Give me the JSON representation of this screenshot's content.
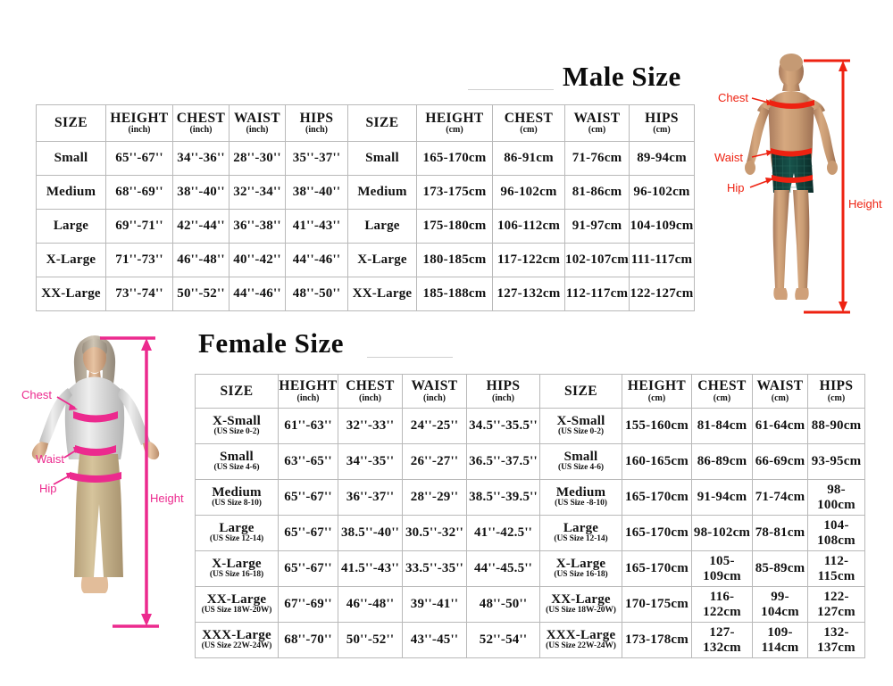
{
  "male": {
    "title": "Male Size",
    "headers": [
      {
        "main": "SIZE",
        "unit": ""
      },
      {
        "main": "HEIGHT",
        "unit": "(inch)"
      },
      {
        "main": "CHEST",
        "unit": "(inch)"
      },
      {
        "main": "WAIST",
        "unit": "(inch)"
      },
      {
        "main": "HIPS",
        "unit": "(inch)"
      },
      {
        "main": "SIZE",
        "unit": ""
      },
      {
        "main": "HEIGHT",
        "unit": "(cm)"
      },
      {
        "main": "CHEST",
        "unit": "(cm)"
      },
      {
        "main": "WAIST",
        "unit": "(cm)"
      },
      {
        "main": "HIPS",
        "unit": "(cm)"
      }
    ],
    "rows": [
      {
        "size_in": "Small",
        "height_in": "65''-67''",
        "chest_in": "34''-36''",
        "waist_in": "28''-30''",
        "hips_in": "35''-37''",
        "size_cm": "Small",
        "height_cm": "165-170cm",
        "chest_cm": "86-91cm",
        "waist_cm": "71-76cm",
        "hips_cm": "89-94cm"
      },
      {
        "size_in": "Medium",
        "height_in": "68''-69''",
        "chest_in": "38''-40''",
        "waist_in": "32''-34''",
        "hips_in": "38''-40''",
        "size_cm": "Medium",
        "height_cm": "173-175cm",
        "chest_cm": "96-102cm",
        "waist_cm": "81-86cm",
        "hips_cm": "96-102cm"
      },
      {
        "size_in": "Large",
        "height_in": "69''-71''",
        "chest_in": "42''-44''",
        "waist_in": "36''-38''",
        "hips_in": "41''-43''",
        "size_cm": "Large",
        "height_cm": "175-180cm",
        "chest_cm": "106-112cm",
        "waist_cm": "91-97cm",
        "hips_cm": "104-109cm"
      },
      {
        "size_in": "X-Large",
        "height_in": "71''-73''",
        "chest_in": "46''-48''",
        "waist_in": "40''-42''",
        "hips_in": "44''-46''",
        "size_cm": "X-Large",
        "height_cm": "180-185cm",
        "chest_cm": "117-122cm",
        "waist_cm": "102-107cm",
        "hips_cm": "111-117cm"
      },
      {
        "size_in": "XX-Large",
        "height_in": "73''-74''",
        "chest_in": "50''-52''",
        "waist_in": "44''-46''",
        "hips_in": "48''-50''",
        "size_cm": "XX-Large",
        "height_cm": "185-188cm",
        "chest_cm": "127-132cm",
        "waist_cm": "112-117cm",
        "hips_cm": "122-127cm"
      }
    ],
    "figure": {
      "chest_label": "Chest",
      "waist_label": "Waist",
      "hip_label": "Hip",
      "height_label": "Height",
      "accent_color": "#ee2211"
    }
  },
  "female": {
    "title": "Female Size",
    "headers": [
      {
        "main": "SIZE",
        "unit": ""
      },
      {
        "main": "HEIGHT",
        "unit": "(inch)"
      },
      {
        "main": "CHEST",
        "unit": "(inch)"
      },
      {
        "main": "WAIST",
        "unit": "(inch)"
      },
      {
        "main": "HIPS",
        "unit": "(inch)"
      },
      {
        "main": "SIZE",
        "unit": ""
      },
      {
        "main": "HEIGHT",
        "unit": "(cm)"
      },
      {
        "main": "CHEST",
        "unit": "(cm)"
      },
      {
        "main": "WAIST",
        "unit": "(cm)"
      },
      {
        "main": "HIPS",
        "unit": "(cm)"
      }
    ],
    "rows": [
      {
        "size_in": "X-Small",
        "size_in_sub": "(US Size 0-2)",
        "height_in": "61''-63''",
        "chest_in": "32''-33''",
        "waist_in": "24''-25''",
        "hips_in": "34.5''-35.5''",
        "size_cm": "X-Small",
        "size_cm_sub": "(US Size 0-2)",
        "height_cm": "155-160cm",
        "chest_cm": "81-84cm",
        "waist_cm": "61-64cm",
        "hips_cm": "88-90cm"
      },
      {
        "size_in": "Small",
        "size_in_sub": "(US Size 4-6)",
        "height_in": "63''-65''",
        "chest_in": "34''-35''",
        "waist_in": "26''-27''",
        "hips_in": "36.5''-37.5''",
        "size_cm": "Small",
        "size_cm_sub": "(US Size 4-6)",
        "height_cm": "160-165cm",
        "chest_cm": "86-89cm",
        "waist_cm": "66-69cm",
        "hips_cm": "93-95cm"
      },
      {
        "size_in": "Medium",
        "size_in_sub": "(US Size 8-10)",
        "height_in": "65''-67''",
        "chest_in": "36''-37''",
        "waist_in": "28''-29''",
        "hips_in": "38.5''-39.5''",
        "size_cm": "Medium",
        "size_cm_sub": "(US Size -8-10)",
        "height_cm": "165-170cm",
        "chest_cm": "91-94cm",
        "waist_cm": "71-74cm",
        "hips_cm": "98-100cm"
      },
      {
        "size_in": "Large",
        "size_in_sub": "(US Size 12-14)",
        "height_in": "65''-67''",
        "chest_in": "38.5''-40''",
        "waist_in": "30.5''-32''",
        "hips_in": "41''-42.5''",
        "size_cm": "Large",
        "size_cm_sub": "(US Size 12-14)",
        "height_cm": "165-170cm",
        "chest_cm": "98-102cm",
        "waist_cm": "78-81cm",
        "hips_cm": "104-108cm"
      },
      {
        "size_in": "X-Large",
        "size_in_sub": "(US Size 16-18)",
        "height_in": "65''-67''",
        "chest_in": "41.5''-43''",
        "waist_in": "33.5''-35''",
        "hips_in": "44''-45.5''",
        "size_cm": "X-Large",
        "size_cm_sub": "(US Size 16-18)",
        "height_cm": "165-170cm",
        "chest_cm": "105-109cm",
        "waist_cm": "85-89cm",
        "hips_cm": "112-115cm"
      },
      {
        "size_in": "XX-Large",
        "size_in_sub": "(US Size 18W-20W)",
        "height_in": "67''-69''",
        "chest_in": "46''-48''",
        "waist_in": "39''-41''",
        "hips_in": "48''-50''",
        "size_cm": "XX-Large",
        "size_cm_sub": "(US Size 18W-20W)",
        "height_cm": "170-175cm",
        "chest_cm": "116-122cm",
        "waist_cm": "99-104cm",
        "hips_cm": "122-127cm"
      },
      {
        "size_in": "XXX-Large",
        "size_in_sub": "(US Size 22W-24W)",
        "height_in": "68''-70''",
        "chest_in": "50''-52''",
        "waist_in": "43''-45''",
        "hips_in": "52''-54''",
        "size_cm": "XXX-Large",
        "size_cm_sub": "(US Size 22W-24W)",
        "height_cm": "173-178cm",
        "chest_cm": "127-132cm",
        "waist_cm": "109-114cm",
        "hips_cm": "132-137cm"
      }
    ],
    "figure": {
      "chest_label": "Chest",
      "waist_label": "Waist",
      "hip_label": "Hip",
      "height_label": "Height",
      "accent_color": "#ec2a8e"
    }
  }
}
